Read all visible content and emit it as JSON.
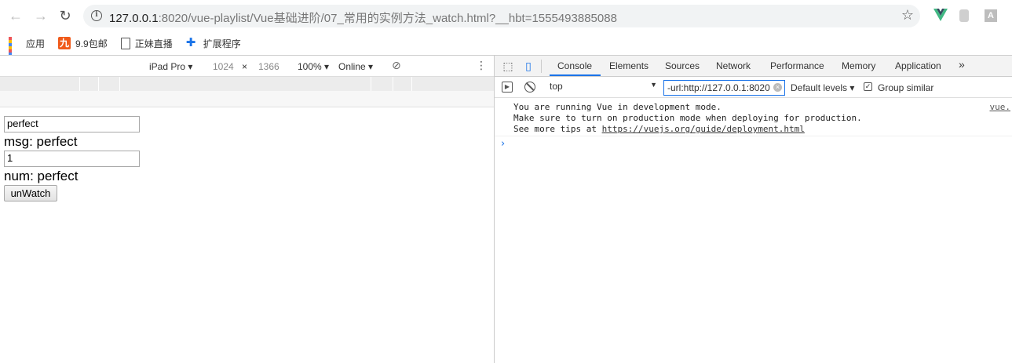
{
  "browser": {
    "url_host": "127.0.0.1",
    "url_rest": ":8020/vue-playlist/Vue基础进阶/07_常用的实例方法_watch.html?__hbt=1555493885088",
    "ext_abp_label": "A"
  },
  "bookmarks": [
    {
      "label": "应用",
      "icon": "apps-grid-icon"
    },
    {
      "label": "9.9包邮",
      "icon": "nine-logo-icon",
      "badge": "九"
    },
    {
      "label": "正妹直播",
      "icon": "page-icon"
    },
    {
      "label": "扩展程序",
      "icon": "puzzle-icon"
    }
  ],
  "device_toolbar": {
    "device": "iPad Pro",
    "width": "1024",
    "times": "×",
    "height": "1366",
    "zoom": "100%",
    "network": "Online"
  },
  "viewport": {
    "msg_input_value": "perfect",
    "msg_text": "msg: perfect",
    "num_input_value": "1",
    "num_text": "num: perfect",
    "unwatch_button": "unWatch"
  },
  "devtools": {
    "tabs": [
      "Console",
      "Elements",
      "Sources",
      "Network",
      "Performance",
      "Memory",
      "Application"
    ],
    "more": "»",
    "context": "top",
    "filter_value": "-url:http://127.0.0.1:8020",
    "levels": "Default levels",
    "group_similar": "Group similar"
  },
  "console": {
    "line1": "You are running Vue in development mode.",
    "line2": "Make sure to turn on production mode when deploying for production.",
    "line3_prefix": "See more tips at ",
    "line3_link": "https://vuejs.org/guide/deployment.html",
    "source": "vue.",
    "prompt": "›"
  },
  "colors": {
    "accent": "#1a73e8",
    "vue_green": "#41b883",
    "vue_dark": "#35495e"
  }
}
